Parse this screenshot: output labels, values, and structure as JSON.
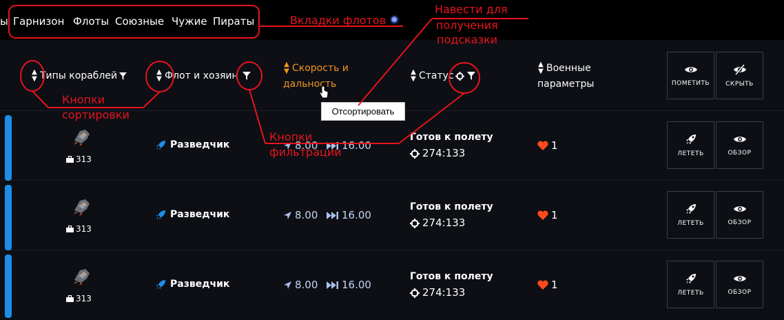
{
  "tabs": [
    "ы",
    "Гарнизон",
    "Флоты",
    "Союзные",
    "Чужие",
    "Пираты"
  ],
  "header": {
    "ship_types": "Типы кораблей",
    "fleet_owner": "Флот и хозяин",
    "speed_line1": "Скорость и",
    "speed_line2": "дальность",
    "status": "Статус",
    "military_line1": "Военные",
    "military_line2": "параметры",
    "mark_button": "ПОМЕТИТЬ",
    "hide_button": "СКРЫТЬ"
  },
  "tooltip": "Отсортировать",
  "rows": [
    {
      "cargo": "313",
      "fleet": "Разведчик",
      "speed": "8.00",
      "range": "16.00",
      "status": "Готов к полету",
      "coords": "274:133",
      "hp": "1",
      "fly": "ЛЕТЕТЬ",
      "view": "ОБЗОР"
    },
    {
      "cargo": "313",
      "fleet": "Разведчик",
      "speed": "8.00",
      "range": "16.00",
      "status": "Готов к полету",
      "coords": "274:133",
      "hp": "1",
      "fly": "ЛЕТЕТЬ",
      "view": "ОБЗОР"
    },
    {
      "cargo": "313",
      "fleet": "Разведчик",
      "speed": "8.00",
      "range": "16.00",
      "status": "Готов к полету",
      "coords": "274:133",
      "hp": "1",
      "fly": "ЛЕТЕТЬ",
      "view": "ОБЗОР"
    }
  ],
  "annotations": {
    "tabs": "Вкладки флотов",
    "hover": [
      "Навести для",
      "получения",
      "подсказки"
    ],
    "sort": [
      "Кнопки",
      "сортировки"
    ],
    "filter": [
      "Кнопки",
      "фильтрации"
    ]
  },
  "colors": {
    "accent_blue": "#1b8fe8",
    "sort_orange": "#f0951f",
    "annotation_red": "#e8141c",
    "heart": "#ff4a1c"
  },
  "icons": [
    "sort-icon",
    "filter-icon",
    "eye-icon",
    "eye-slash-icon",
    "rocket-icon",
    "navigation-arrow-icon",
    "fast-forward-icon",
    "crosshair-icon",
    "heart-icon",
    "briefcase-icon",
    "ship-icon"
  ]
}
